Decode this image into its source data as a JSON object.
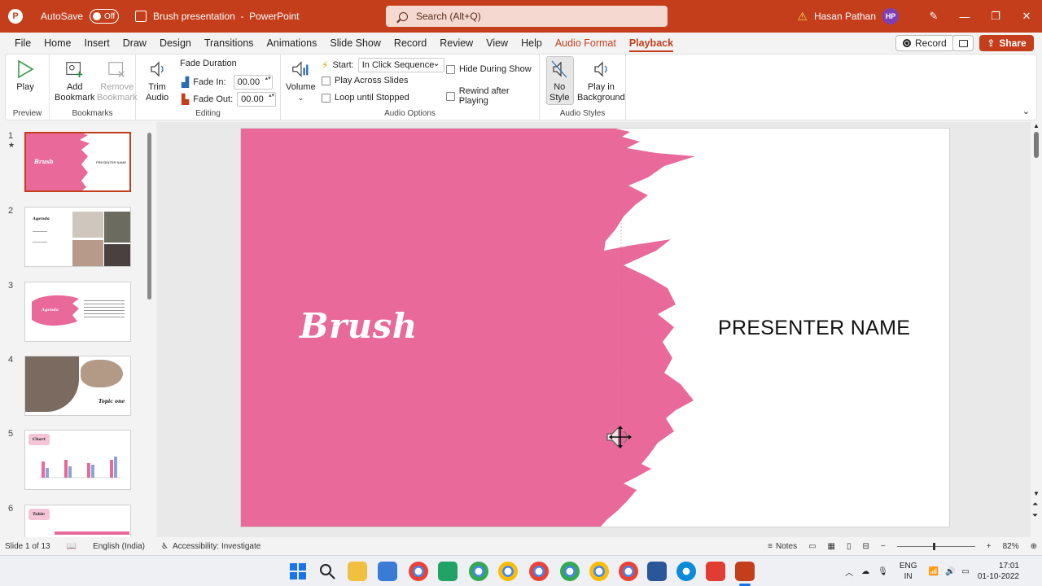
{
  "window": {
    "autosave_label": "AutoSave",
    "autosave_state": "Off",
    "doc_title": "Brush presentation",
    "app_name": "PowerPoint",
    "search_placeholder": "Search (Alt+Q)",
    "user_name": "Hasan Pathan",
    "user_initials": "HP"
  },
  "tabs": [
    "File",
    "Home",
    "Insert",
    "Draw",
    "Design",
    "Transitions",
    "Animations",
    "Slide Show",
    "Record",
    "Review",
    "View",
    "Help",
    "Audio Format",
    "Playback"
  ],
  "active_tab": "Playback",
  "header_buttons": {
    "record": "Record",
    "share": "Share"
  },
  "ribbon": {
    "preview": {
      "label": "Preview",
      "play": "Play"
    },
    "bookmarks": {
      "label": "Bookmarks",
      "add": "Add\nBookmark",
      "add_l1": "Add",
      "add_l2": "Bookmark",
      "remove_l1": "Remove",
      "remove_l2": "Bookmark"
    },
    "editing": {
      "label": "Editing",
      "trim_l1": "Trim",
      "trim_l2": "Audio",
      "fade_duration": "Fade Duration",
      "fade_in_label": "Fade In:",
      "fade_in_value": "00.00",
      "fade_out_label": "Fade Out:",
      "fade_out_value": "00.00"
    },
    "audio_options": {
      "label": "Audio Options",
      "volume": "Volume",
      "start_label": "Start:",
      "start_value": "In Click Sequence",
      "play_across": "Play Across Slides",
      "loop": "Loop until Stopped",
      "hide": "Hide During Show",
      "rewind": "Rewind after Playing"
    },
    "audio_styles": {
      "label": "Audio Styles",
      "nostyle_l1": "No",
      "nostyle_l2": "Style",
      "bg_l1": "Play in",
      "bg_l2": "Background"
    }
  },
  "slides": [
    {
      "num": "1",
      "star": "★",
      "title": "Brush",
      "sub": "PRESENTER NAME"
    },
    {
      "num": "2",
      "title": "Agenda"
    },
    {
      "num": "3",
      "title": "Agenda"
    },
    {
      "num": "4",
      "title": "Topic one"
    },
    {
      "num": "5",
      "title": "Chart"
    },
    {
      "num": "6",
      "title": "Table"
    }
  ],
  "main_slide": {
    "title": "Brush",
    "presenter": "PRESENTER NAME"
  },
  "status": {
    "slide_count": "Slide 1 of 13",
    "language": "English (India)",
    "accessibility": "Accessibility: Investigate",
    "notes": "Notes",
    "zoom": "82%"
  },
  "tray": {
    "lang1": "ENG",
    "lang2": "IN",
    "time": "17:01",
    "date": "01-10-2022"
  },
  "colors": {
    "accent": "#c43e1c",
    "slide_pink": "#e8699a"
  }
}
